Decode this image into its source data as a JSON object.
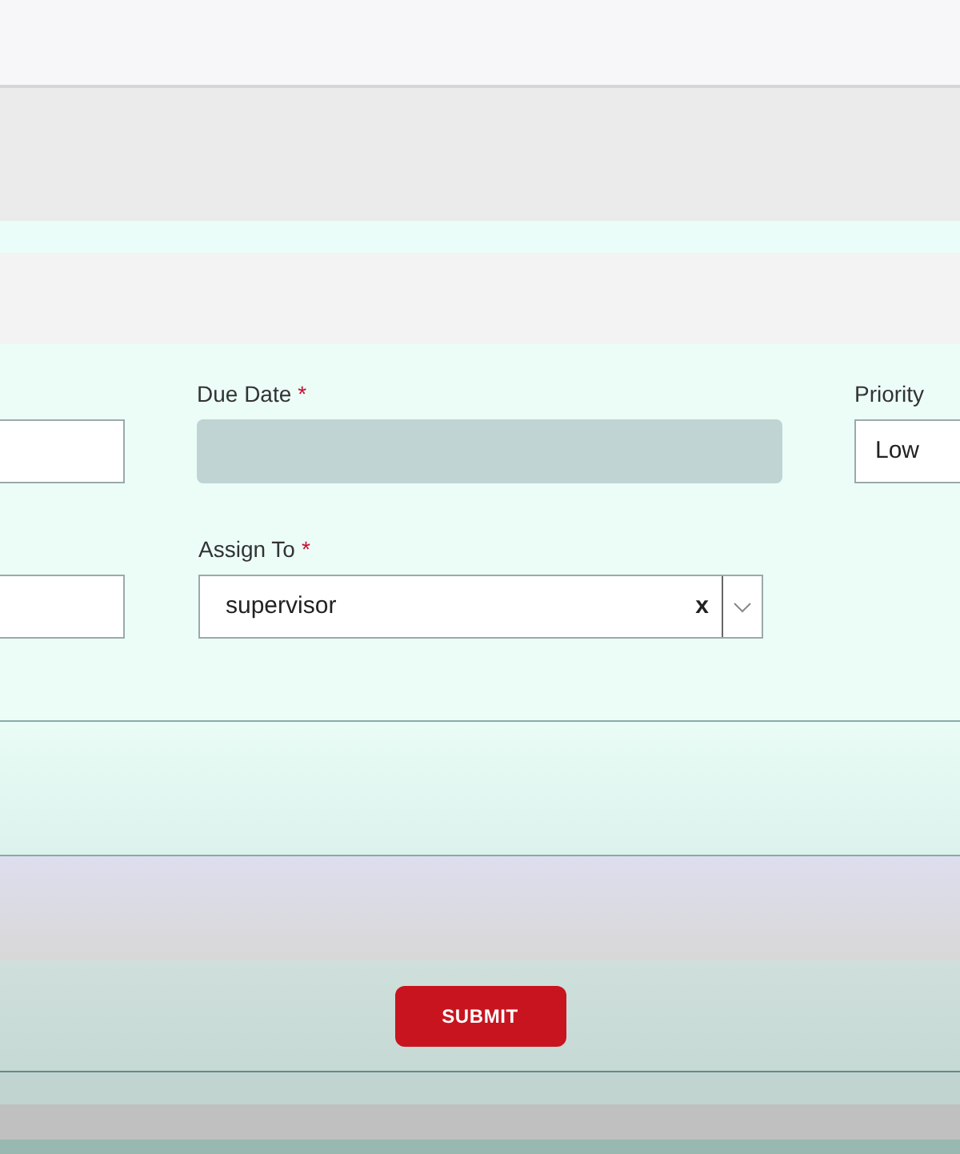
{
  "form": {
    "row_1": [
      {
        "kind": "blank"
      },
      {
        "kind": "date",
        "label": "Due Date",
        "required_mark": "*",
        "disabled": true
      },
      {
        "kind": "select",
        "label": "Priority",
        "value": "Low"
      }
    ],
    "row_2": [
      {
        "kind": "blank"
      },
      {
        "kind": "combobox",
        "label": "Assign To",
        "required_mark": "*",
        "value": "supervisor",
        "clear": "x"
      }
    ]
  },
  "submit_button": "SUBMIT"
}
